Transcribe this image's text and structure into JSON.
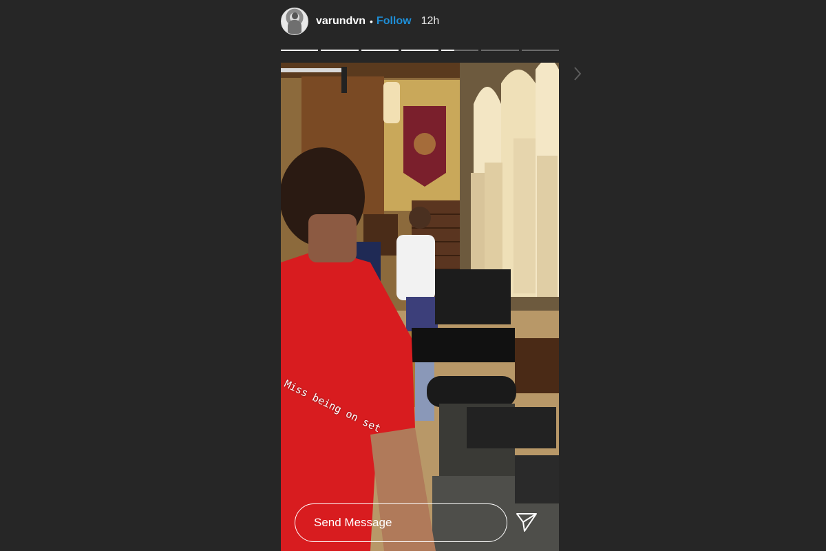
{
  "header": {
    "username": "varundvn",
    "separator": "•",
    "follow_label": "Follow",
    "time": "12h",
    "avatar_icon": "profile-avatar"
  },
  "progress": {
    "segments": [
      1,
      1,
      1,
      1,
      0.35,
      0,
      0
    ]
  },
  "story": {
    "caption": "Miss being on set",
    "image_description_icon": "story-photo"
  },
  "reply": {
    "placeholder": "Send Message",
    "send_icon": "paper-plane-icon"
  },
  "colors": {
    "background": "#262626",
    "follow": "#1e8fd8",
    "progress_fill": "#ffffff",
    "progress_track": "#6b6b6b"
  }
}
